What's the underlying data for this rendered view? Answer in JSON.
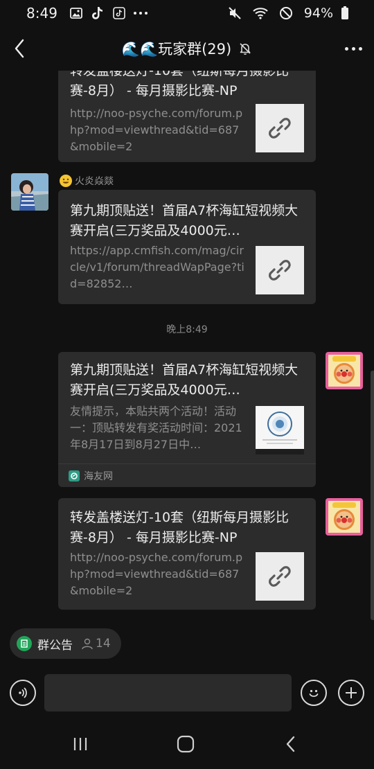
{
  "status_bar": {
    "time": "8:49",
    "battery": "94%"
  },
  "header": {
    "title": "🌊🌊玩家群(29)"
  },
  "messages": [
    {
      "title": "转发盖楼送灯-10套（纽斯每月摄影比赛-8月） - 每月摄影比赛-NP",
      "desc": "http://noo-psyche.com/forum.php?mod=viewthread&tid=687&mobile=2"
    },
    {
      "sender": "火炎焱燚",
      "title": "第九期顶贴送！首届A7杯海缸短视频大赛开启(三万奖品及4000元…",
      "desc": "https://app.cmfish.com/mag/circle/v1/forum/threadWapPage?tid=82852…"
    },
    {
      "time_divider": "晚上8:49"
    },
    {
      "title": "第九期顶贴送！首届A7杯海缸短视频大赛开启(三万奖品及4000元…",
      "desc": "友情提示，本贴共两个活动！活动一：顶贴转发有奖活动时间：2021年8月17日到8月27日中…",
      "source": "海友网"
    },
    {
      "title": "转发盖楼送灯-10套（纽斯每月摄影比赛-8月） - 每月摄影比赛-NP",
      "desc": "http://noo-psyche.com/forum.php?mod=viewthread&tid=687&mobile=2"
    }
  ],
  "notice": {
    "label": "群公告",
    "count": "14"
  },
  "input": {
    "value": "",
    "placeholder": ""
  },
  "colors": {
    "background": "#111111",
    "bubble": "#2c2c2c",
    "notice_green": "#22a55a"
  }
}
